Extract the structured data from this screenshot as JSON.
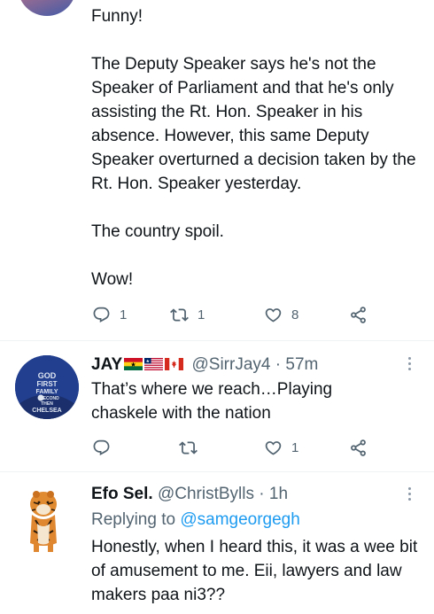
{
  "tweet1": {
    "text": "Funny!\n\nThe Deputy Speaker says he's not the Speaker of Parliament and that he's only assisting the Rt. Hon. Speaker in his absence. However, this same Deputy Speaker overturned a decision taken by the Rt. Hon. Speaker yesterday.\n\nThe country spoil.\n\nWow!",
    "replies": "1",
    "retweets": "1",
    "likes": "8"
  },
  "tweet2": {
    "name": "JAY",
    "handle": "@SirrJay4",
    "separator": "·",
    "time": "57m",
    "avatar_text": [
      "GOD",
      "FIRST",
      "FAMILY",
      "SECOND",
      "THEN",
      "CHELSEA"
    ],
    "text": "That’s where we reach…Playing chaskele with the nation",
    "replies": "",
    "retweets": "",
    "likes": "1"
  },
  "tweet3": {
    "name": "Efo Sel.",
    "handle": "@ChristBylls",
    "separator": "·",
    "time": "1h",
    "replying_prefix": "Replying to",
    "replying_to": "@samgeorgegh",
    "text": "Honestly, when I heard this, it was a wee bit of amusement to me. Eii, lawyers and law makers paa ni3??"
  },
  "colors": {
    "accent": "#1d9bf0",
    "secondary_text": "#536471",
    "divider": "#eff3f4"
  },
  "icons": [
    "reply-icon",
    "retweet-icon",
    "like-icon",
    "share-icon",
    "more-icon"
  ]
}
